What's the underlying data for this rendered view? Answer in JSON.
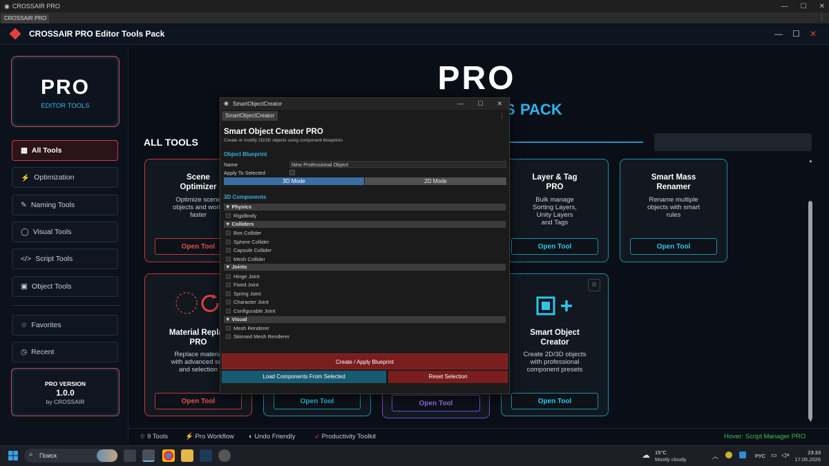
{
  "os_window": {
    "title": "CROSSAIR PRO",
    "tab": "CROSSAIR PRO"
  },
  "app": {
    "title": "CROSSAIR PRO Editor Tools Pack",
    "accent_red": "#e0413a",
    "accent_cyan": "#2fb4ec"
  },
  "sidebar": {
    "logo_title": "PRO",
    "logo_sub": "EDITOR TOOLS",
    "items": [
      {
        "icon": "▦",
        "label": "All Tools"
      },
      {
        "icon": "⚡",
        "label": "Optimization"
      },
      {
        "icon": "✎",
        "label": "Naming Tools"
      },
      {
        "icon": "◯",
        "label": "Visual Tools"
      },
      {
        "icon": "</>",
        "label": "Script Tools"
      },
      {
        "icon": "▣",
        "label": "Object Tools"
      }
    ],
    "extra": [
      {
        "icon": "☆",
        "label": "Favorites"
      },
      {
        "icon": "◷",
        "label": "Recent"
      }
    ],
    "version": {
      "label": "PRO VERSION",
      "number": "1.0.0",
      "by": "by CROSSAIR"
    }
  },
  "hero": {
    "title": "PRO",
    "pack_fragment": "S",
    "pack": "PACK"
  },
  "section_title": "ALL TOOLS",
  "cards": [
    {
      "title1": "Scene",
      "title2": "Optimizer",
      "desc1": "Optimize scene",
      "desc2": "objects and workf",
      "desc3": "faster",
      "button": "Open Tool"
    },
    {
      "title1": "Layer & Tag",
      "title2": "PRO",
      "desc1": "Bulk manage",
      "desc2": "Sorting Layers,",
      "desc3": "Unity Layers",
      "desc4": "and Tags",
      "button": "Open Tool"
    },
    {
      "title1": "Smart Mass",
      "title2": "Renamer",
      "desc1": "Rename multiple",
      "desc2": "objects with smart",
      "desc3": "rules",
      "button": "Open Tool"
    },
    {
      "title1": "Material Replac",
      "title2": "PRO",
      "desc1": "Replace materia",
      "desc2": "with advanced sea",
      "desc3": "and selection",
      "button": "Open Tool"
    },
    {
      "button": "Open Tool"
    },
    {
      "button": "Open Tool"
    },
    {
      "title1": "Smart Object",
      "title2": "Creator",
      "desc1": "Create 2D/3D objects",
      "desc2": "with professional",
      "desc3": "component presets",
      "button": "Open Tool"
    }
  ],
  "footer": {
    "tools": "9 Tools",
    "workflow": "Pro Workflow",
    "undo": "Undo Friendly",
    "productivity": "Productivity Toolkit",
    "hover": "Hover: Script Manager PRO"
  },
  "dialog": {
    "window_title": "SmartObjectCreator",
    "tab": "SmartObjectCreator",
    "heading": "Smart Object Creator PRO",
    "subheading": "Create or modify 2D/3D objects using component blueprints",
    "blueprint_section": "Object Blueprint",
    "name_label": "Name",
    "name_value": "New Professional Object",
    "apply_label": "Apply To Selected",
    "mode_3d": "3D Mode",
    "mode_2d": "2D Mode",
    "components_section": "3D Components",
    "groups": [
      {
        "name": "Physics",
        "items": [
          "Rigidbody"
        ]
      },
      {
        "name": "Colliders",
        "items": [
          "Box Collider",
          "Sphere Collider",
          "Capsule Collider",
          "Mesh Collider"
        ]
      },
      {
        "name": "Joints",
        "items": [
          "Hinge Joint",
          "Fixed Joint",
          "Spring Joint",
          "Character Joint",
          "Configurable Joint"
        ]
      },
      {
        "name": "Visual",
        "items": [
          "Mesh Renderer",
          "Skinned Mesh Renderer"
        ]
      }
    ],
    "create_button": "Create / Apply Blueprint",
    "load_button": "Load Components From Selected",
    "reset_button": "Reset Selection"
  },
  "taskbar": {
    "search": "Поиск",
    "weather_temp": "15°C",
    "weather_desc": "Mostly cloudy",
    "lang": "РУС",
    "time": "23:33",
    "date": "17.05.2026"
  }
}
